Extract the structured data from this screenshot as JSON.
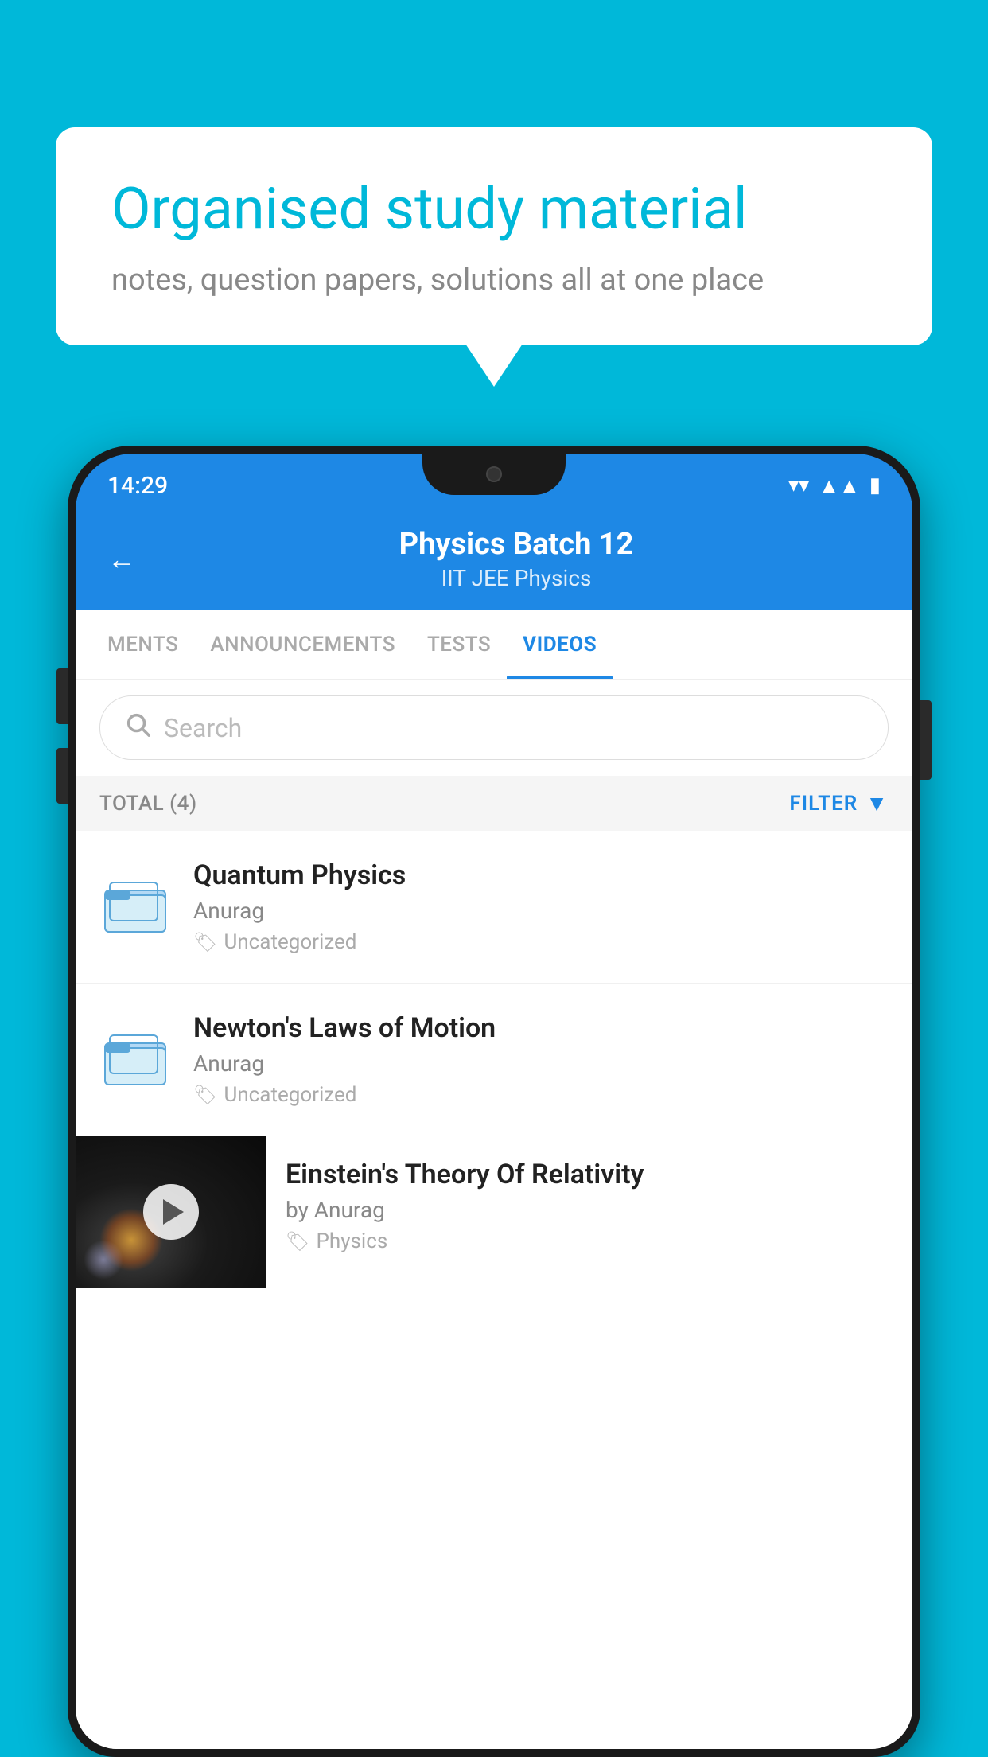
{
  "background_color": "#00B8D9",
  "bubble": {
    "title": "Organised study material",
    "subtitle": "notes, question papers, solutions all at one place"
  },
  "status_bar": {
    "time": "14:29",
    "wifi": "▾",
    "signal": "▲",
    "battery": "▮"
  },
  "header": {
    "title": "Physics Batch 12",
    "subtitle": "IIT JEE   Physics",
    "back_label": "←"
  },
  "tabs": [
    {
      "label": "MENTS",
      "active": false
    },
    {
      "label": "ANNOUNCEMENTS",
      "active": false
    },
    {
      "label": "TESTS",
      "active": false
    },
    {
      "label": "VIDEOS",
      "active": true
    }
  ],
  "search": {
    "placeholder": "Search"
  },
  "filter_bar": {
    "total_label": "TOTAL (4)",
    "filter_label": "FILTER"
  },
  "videos": [
    {
      "title": "Quantum Physics",
      "author": "Anurag",
      "tag": "Uncategorized",
      "type": "folder"
    },
    {
      "title": "Newton's Laws of Motion",
      "author": "Anurag",
      "tag": "Uncategorized",
      "type": "folder"
    },
    {
      "title": "Einstein's Theory Of Relativity",
      "author": "by Anurag",
      "tag": "Physics",
      "type": "video"
    }
  ]
}
